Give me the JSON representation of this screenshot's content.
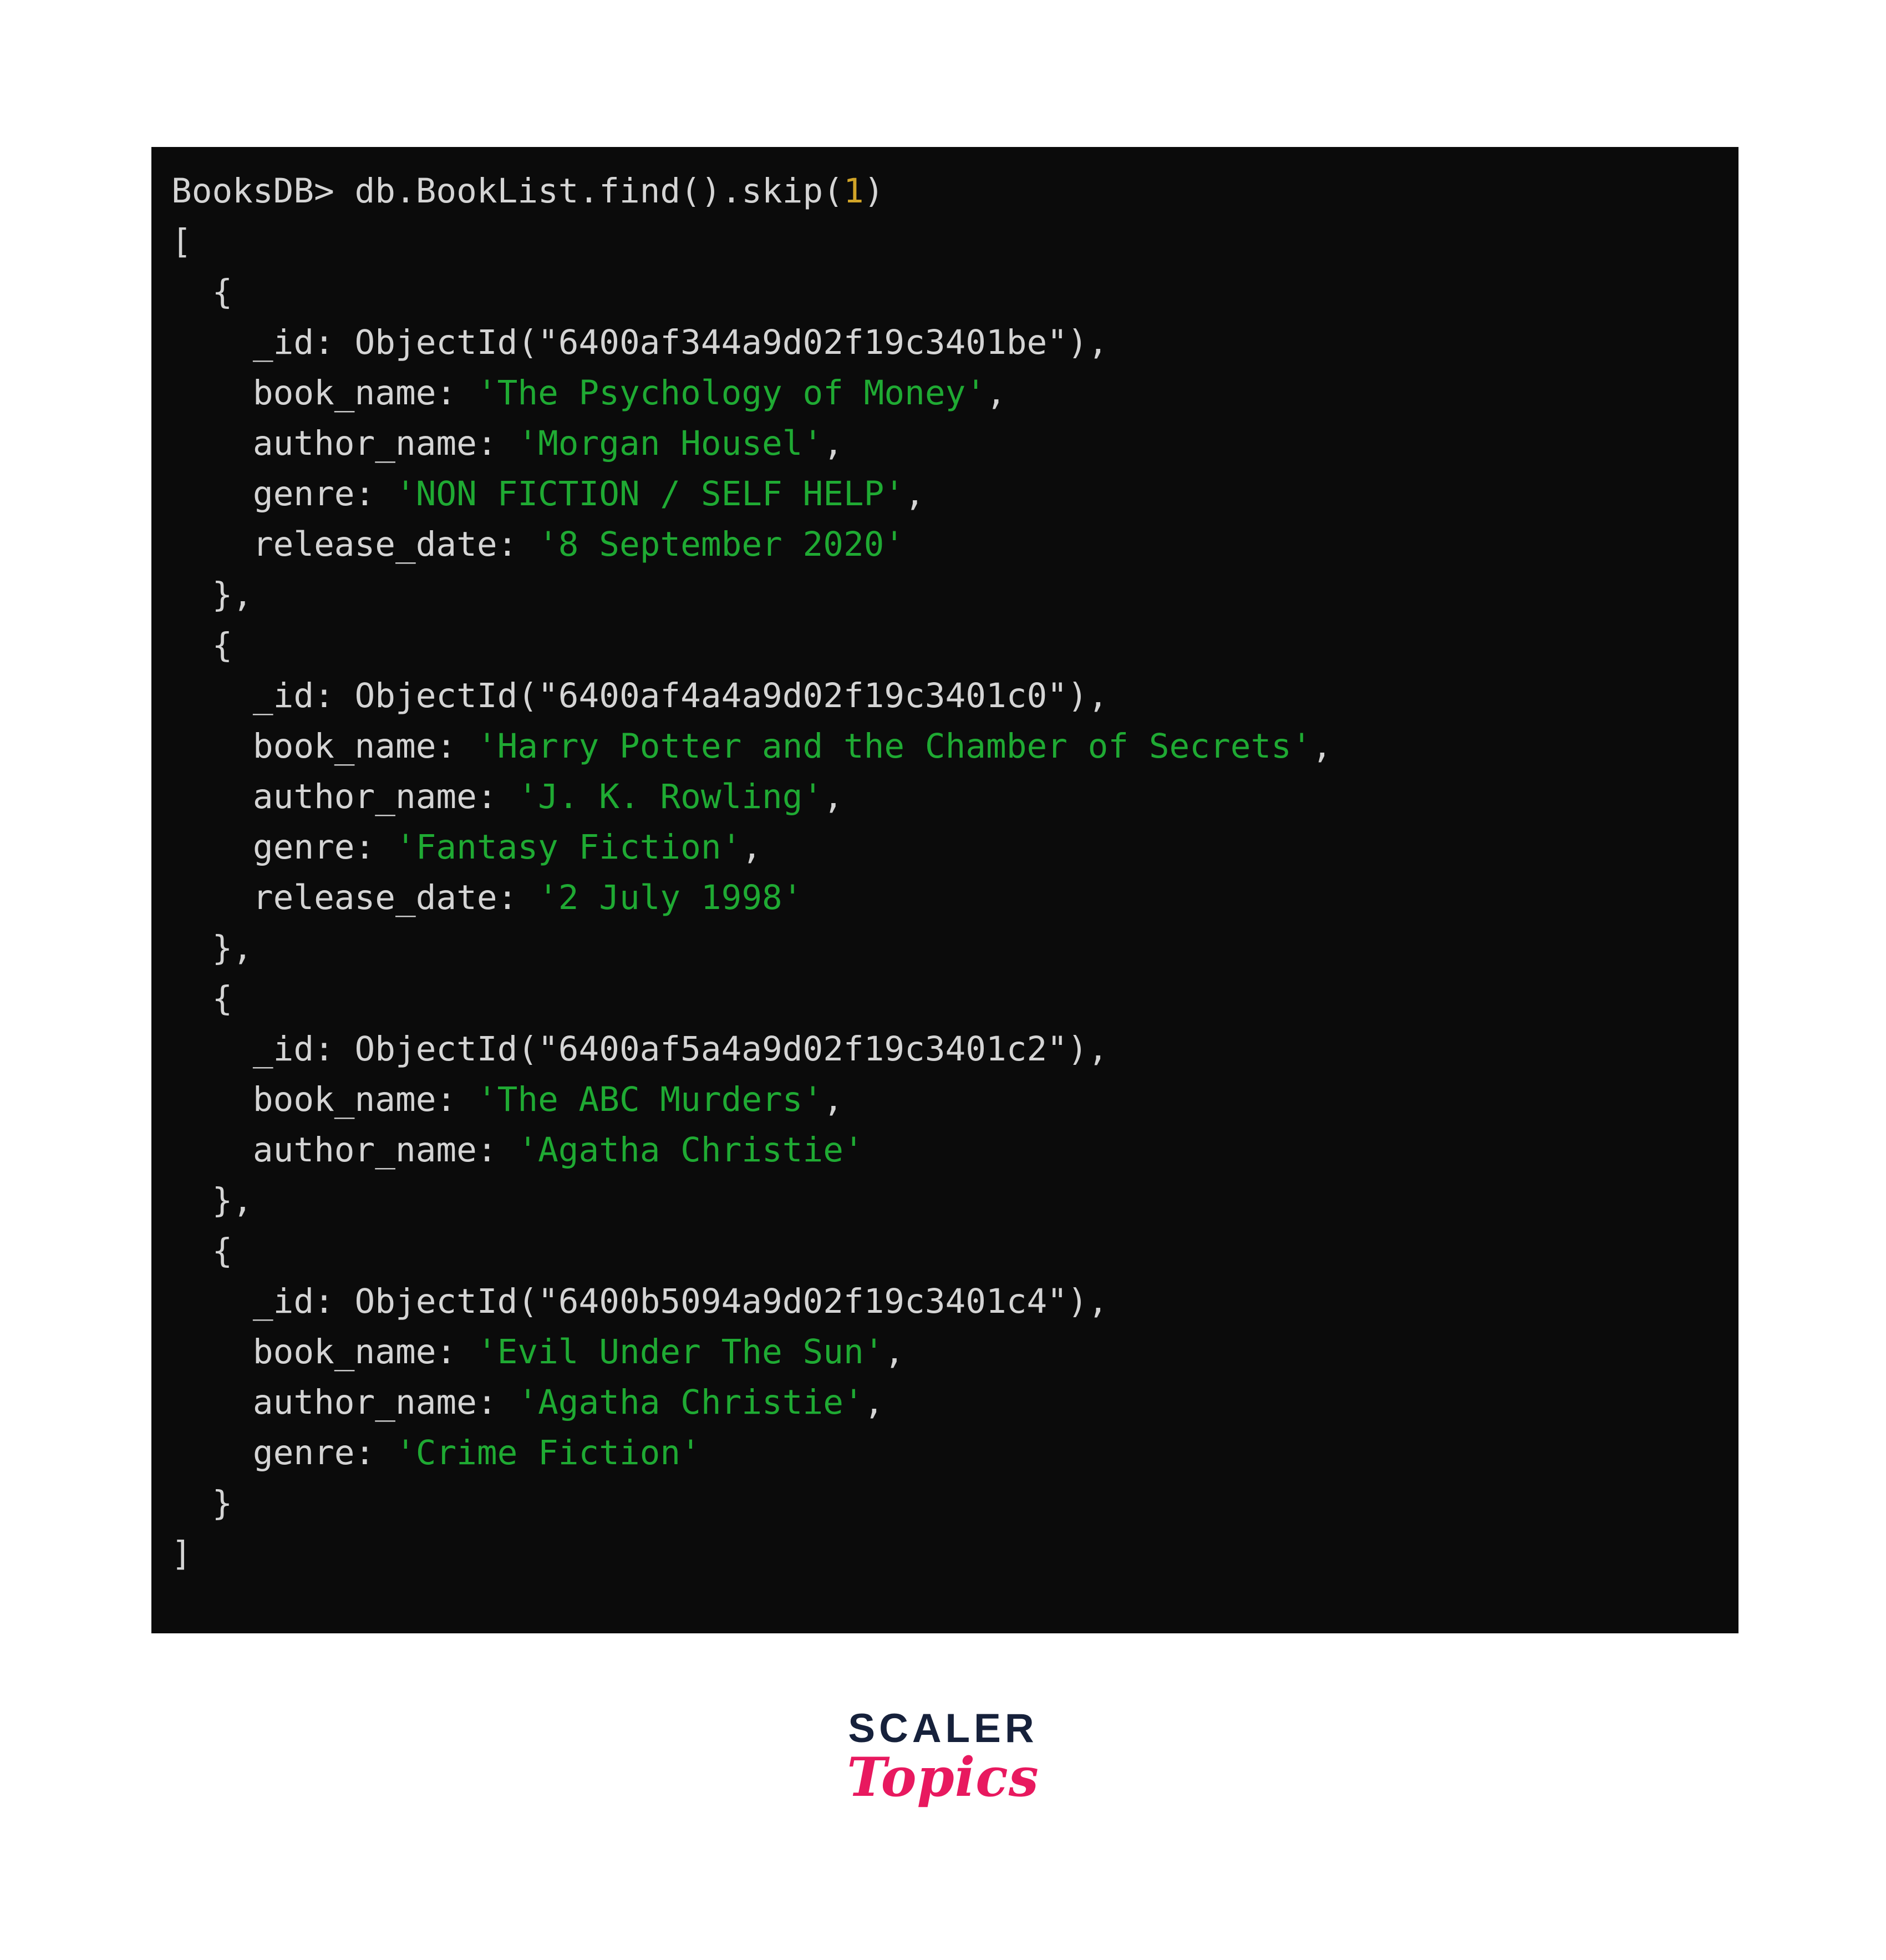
{
  "terminal": {
    "prompt": "BooksDB>",
    "command": "db.BookList.find().skip(1)",
    "command_argument": "1",
    "colors": {
      "background": "#0b0b0b",
      "text": "#d4d4d4",
      "string": "#1faa33",
      "number": "#d1a428"
    },
    "lines": [
      {
        "indent": 0,
        "tokens": [
          {
            "text": "BooksDB> db.BookList.find().skip(",
            "type": "plain"
          },
          {
            "text": "1",
            "type": "number"
          },
          {
            "text": ")",
            "type": "plain"
          }
        ]
      },
      {
        "indent": 0,
        "tokens": [
          {
            "text": "[",
            "type": "plain"
          }
        ]
      },
      {
        "indent": 1,
        "tokens": [
          {
            "text": "{",
            "type": "plain"
          }
        ]
      },
      {
        "indent": 2,
        "tokens": [
          {
            "text": "_id: ObjectId(\"6400af344a9d02f19c3401be\"),",
            "type": "plain"
          }
        ]
      },
      {
        "indent": 2,
        "tokens": [
          {
            "text": "book_name: ",
            "type": "plain"
          },
          {
            "text": "'The Psychology of Money'",
            "type": "string"
          },
          {
            "text": ",",
            "type": "plain"
          }
        ]
      },
      {
        "indent": 2,
        "tokens": [
          {
            "text": "author_name: ",
            "type": "plain"
          },
          {
            "text": "'Morgan Housel'",
            "type": "string"
          },
          {
            "text": ",",
            "type": "plain"
          }
        ]
      },
      {
        "indent": 2,
        "tokens": [
          {
            "text": "genre: ",
            "type": "plain"
          },
          {
            "text": "'NON FICTION / SELF HELP'",
            "type": "string"
          },
          {
            "text": ",",
            "type": "plain"
          }
        ]
      },
      {
        "indent": 2,
        "tokens": [
          {
            "text": "release_date: ",
            "type": "plain"
          },
          {
            "text": "'8 September 2020'",
            "type": "string"
          }
        ]
      },
      {
        "indent": 1,
        "tokens": [
          {
            "text": "},",
            "type": "plain"
          }
        ]
      },
      {
        "indent": 1,
        "tokens": [
          {
            "text": "{",
            "type": "plain"
          }
        ]
      },
      {
        "indent": 2,
        "tokens": [
          {
            "text": "_id: ObjectId(\"6400af4a4a9d02f19c3401c0\"),",
            "type": "plain"
          }
        ]
      },
      {
        "indent": 2,
        "tokens": [
          {
            "text": "book_name: ",
            "type": "plain"
          },
          {
            "text": "'Harry Potter and the Chamber of Secrets'",
            "type": "string"
          },
          {
            "text": ",",
            "type": "plain"
          }
        ]
      },
      {
        "indent": 2,
        "tokens": [
          {
            "text": "author_name: ",
            "type": "plain"
          },
          {
            "text": "'J. K. Rowling'",
            "type": "string"
          },
          {
            "text": ",",
            "type": "plain"
          }
        ]
      },
      {
        "indent": 2,
        "tokens": [
          {
            "text": "genre: ",
            "type": "plain"
          },
          {
            "text": "'Fantasy Fiction'",
            "type": "string"
          },
          {
            "text": ",",
            "type": "plain"
          }
        ]
      },
      {
        "indent": 2,
        "tokens": [
          {
            "text": "release_date: ",
            "type": "plain"
          },
          {
            "text": "'2 July 1998'",
            "type": "string"
          }
        ]
      },
      {
        "indent": 1,
        "tokens": [
          {
            "text": "},",
            "type": "plain"
          }
        ]
      },
      {
        "indent": 1,
        "tokens": [
          {
            "text": "{",
            "type": "plain"
          }
        ]
      },
      {
        "indent": 2,
        "tokens": [
          {
            "text": "_id: ObjectId(\"6400af5a4a9d02f19c3401c2\"),",
            "type": "plain"
          }
        ]
      },
      {
        "indent": 2,
        "tokens": [
          {
            "text": "book_name: ",
            "type": "plain"
          },
          {
            "text": "'The ABC Murders'",
            "type": "string"
          },
          {
            "text": ",",
            "type": "plain"
          }
        ]
      },
      {
        "indent": 2,
        "tokens": [
          {
            "text": "author_name: ",
            "type": "plain"
          },
          {
            "text": "'Agatha Christie'",
            "type": "string"
          }
        ]
      },
      {
        "indent": 1,
        "tokens": [
          {
            "text": "},",
            "type": "plain"
          }
        ]
      },
      {
        "indent": 1,
        "tokens": [
          {
            "text": "{",
            "type": "plain"
          }
        ]
      },
      {
        "indent": 2,
        "tokens": [
          {
            "text": "_id: ObjectId(\"6400b5094a9d02f19c3401c4\"),",
            "type": "plain"
          }
        ]
      },
      {
        "indent": 2,
        "tokens": [
          {
            "text": "book_name: ",
            "type": "plain"
          },
          {
            "text": "'Evil Under The Sun'",
            "type": "string"
          },
          {
            "text": ",",
            "type": "plain"
          }
        ]
      },
      {
        "indent": 2,
        "tokens": [
          {
            "text": "author_name: ",
            "type": "plain"
          },
          {
            "text": "'Agatha Christie'",
            "type": "string"
          },
          {
            "text": ",",
            "type": "plain"
          }
        ]
      },
      {
        "indent": 2,
        "tokens": [
          {
            "text": "genre: ",
            "type": "plain"
          },
          {
            "text": "'Crime Fiction'",
            "type": "string"
          }
        ]
      },
      {
        "indent": 1,
        "tokens": [
          {
            "text": "}",
            "type": "plain"
          }
        ]
      },
      {
        "indent": 0,
        "tokens": [
          {
            "text": "]",
            "type": "plain"
          }
        ]
      }
    ],
    "documents": [
      {
        "_id": "6400af344a9d02f19c3401be",
        "book_name": "The Psychology of Money",
        "author_name": "Morgan Housel",
        "genre": "NON FICTION / SELF HELP",
        "release_date": "8 September 2020"
      },
      {
        "_id": "6400af4a4a9d02f19c3401c0",
        "book_name": "Harry Potter and the Chamber of Secrets",
        "author_name": "J. K. Rowling",
        "genre": "Fantasy Fiction",
        "release_date": "2 July 1998"
      },
      {
        "_id": "6400af5a4a9d02f19c3401c2",
        "book_name": "The ABC Murders",
        "author_name": "Agatha Christie"
      },
      {
        "_id": "6400b5094a9d02f19c3401c4",
        "book_name": "Evil Under The Sun",
        "author_name": "Agatha Christie",
        "genre": "Crime Fiction"
      }
    ]
  },
  "footer": {
    "logo": {
      "primary": "SCALER",
      "secondary": "Topics",
      "primary_color": "#16213b",
      "secondary_color": "#e8195f"
    }
  }
}
